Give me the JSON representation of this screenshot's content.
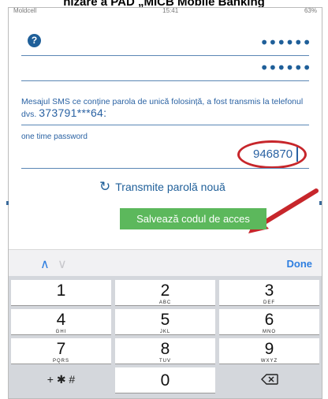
{
  "doc_title": "nizare a PAD „MICB Mobile Banking",
  "status_bar": {
    "carrier": "Moldcell",
    "time": "15:41",
    "battery": "63%"
  },
  "form": {
    "help_symbol": "?",
    "masked_field_1": "••••••",
    "masked_field_2": "••••••",
    "sms_message": "Mesajul SMS ce conține parola de unică folosință, a fost transmis la telefonul dvs.",
    "phone_number": "373791***64:",
    "otp_label": "one time password",
    "otp_value": "946870",
    "resend_label": "Transmite parolă nouă",
    "save_label": "Salvează codul de acces"
  },
  "annotation": {
    "highlight_color": "#c7262b"
  },
  "keyboard": {
    "done_label": "Done",
    "keys": [
      {
        "num": "1",
        "letters": ""
      },
      {
        "num": "2",
        "letters": "ABC"
      },
      {
        "num": "3",
        "letters": "DEF"
      },
      {
        "num": "4",
        "letters": "GHI"
      },
      {
        "num": "5",
        "letters": "JKL"
      },
      {
        "num": "6",
        "letters": "MNO"
      },
      {
        "num": "7",
        "letters": "PQRS"
      },
      {
        "num": "8",
        "letters": "TUV"
      },
      {
        "num": "9",
        "letters": "WXYZ"
      }
    ],
    "symbols_label": "+ ✱ #",
    "zero": "0",
    "delete_icon": "backspace-icon"
  }
}
